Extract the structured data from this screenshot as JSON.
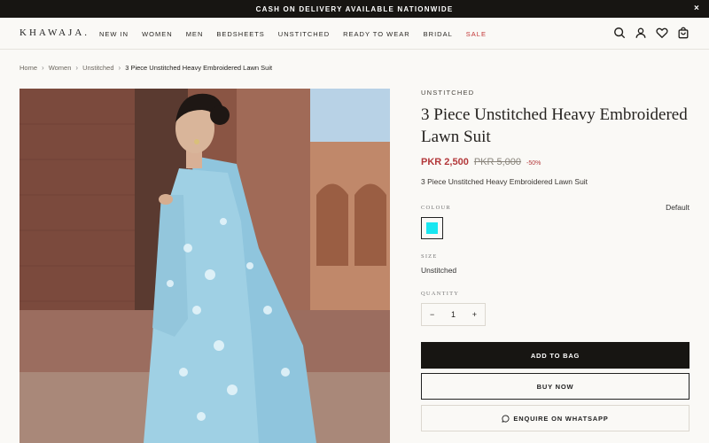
{
  "announcement": {
    "text": "CASH ON DELIVERY AVAILABLE NATIONWIDE",
    "close": "×"
  },
  "header": {
    "logo": "KHAWAJA.",
    "nav": [
      "NEW IN",
      "WOMEN",
      "MEN",
      "BEDSHEETS",
      "UNSTITCHED",
      "READY TO WEAR",
      "BRIDAL",
      "SALE"
    ],
    "icons": [
      "search-icon",
      "account-icon",
      "heart-icon",
      "bag-icon"
    ]
  },
  "breadcrumb": [
    "Home",
    "Women",
    "Unstitched",
    "3 Piece Unstitched Heavy Embroidered Lawn Suit"
  ],
  "product": {
    "category": "UNSTITCHED",
    "title": "3 Piece Unstitched Heavy Embroidered Lawn Suit",
    "price": "PKR 2,500",
    "compare_price": "PKR 5,000",
    "discount": "-50%",
    "description": "3 Piece Unstitched Heavy Embroidered Lawn Suit",
    "colour_label": "COLOUR",
    "colour_value": "Default",
    "swatch_color": "#18e6f0",
    "size_label": "SIZE",
    "size_value": "Unstitched",
    "quantity_label": "QUANTITY",
    "quantity": "1",
    "minus": "−",
    "plus": "+"
  },
  "buttons": {
    "add": "ADD TO BAG",
    "buy": "BUY NOW",
    "whatsapp": "ENQUIRE ON WHATSAPP"
  },
  "colors": {
    "accent": "#b3383a",
    "dark": "#171512",
    "background": "#faf9f6"
  }
}
